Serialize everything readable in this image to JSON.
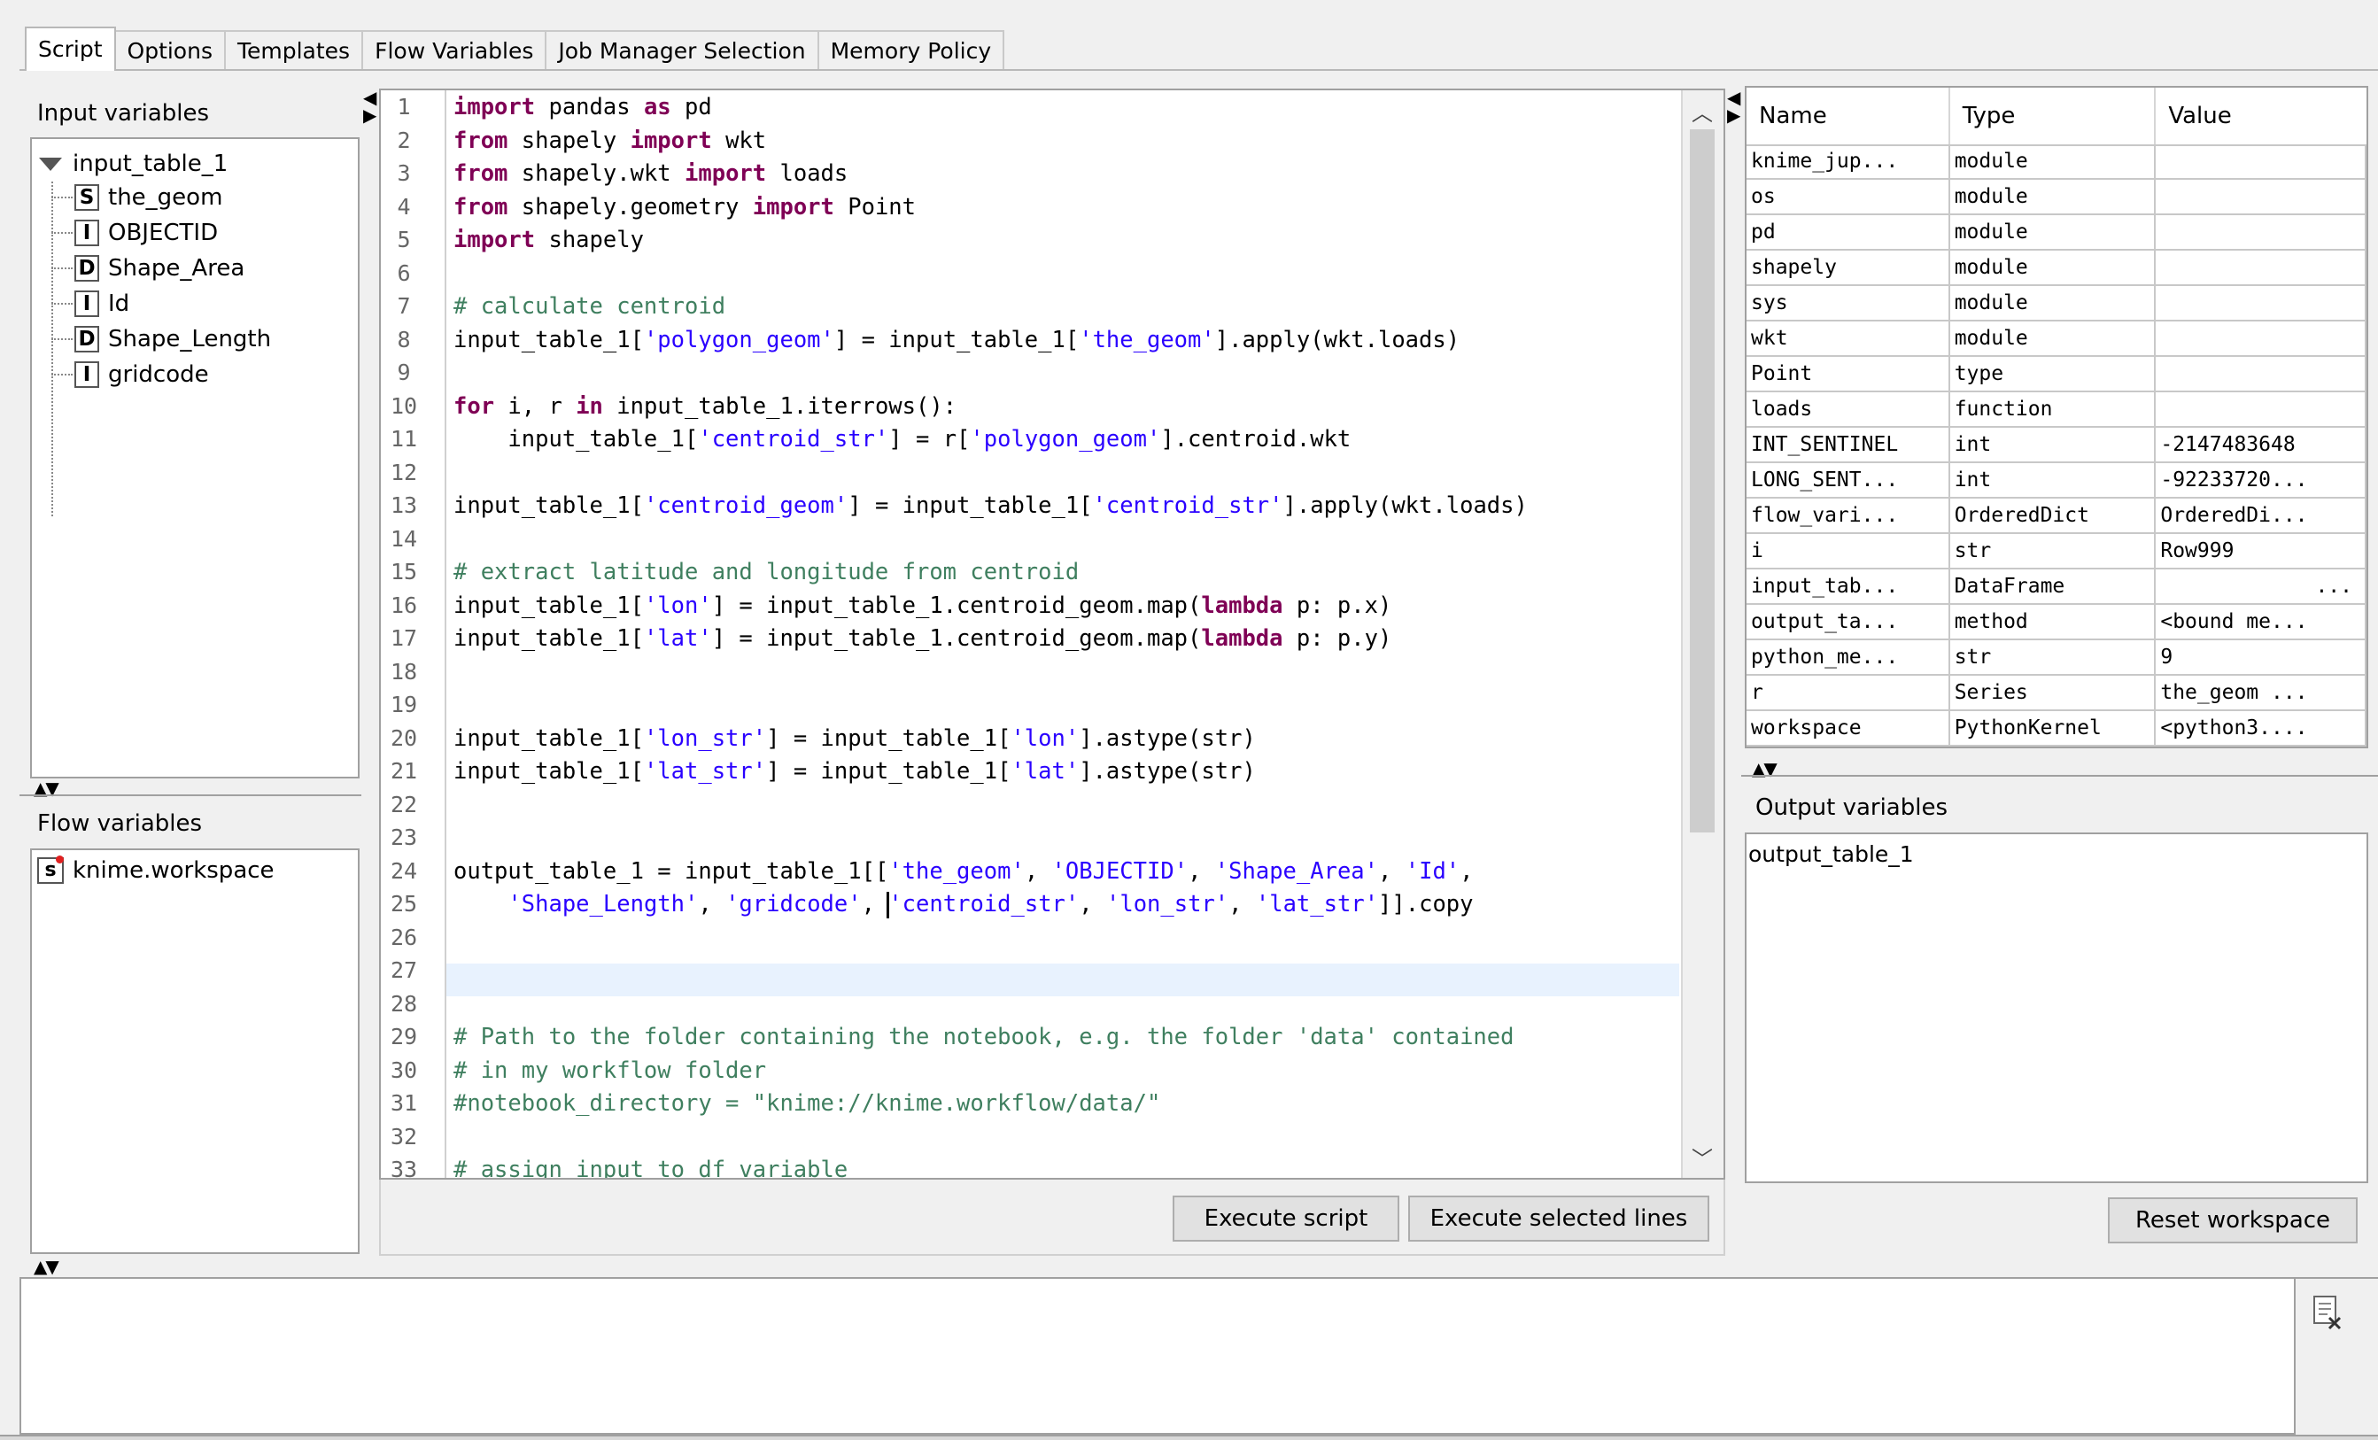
{
  "tabs": [
    "Script",
    "Options",
    "Templates",
    "Flow Variables",
    "Job Manager Selection",
    "Memory Policy"
  ],
  "input_variables": {
    "label": "Input variables",
    "root": "input_table_1",
    "columns": [
      {
        "type": "S",
        "name": "the_geom"
      },
      {
        "type": "I",
        "name": "OBJECTID"
      },
      {
        "type": "D",
        "name": "Shape_Area"
      },
      {
        "type": "I",
        "name": "Id"
      },
      {
        "type": "D",
        "name": "Shape_Length"
      },
      {
        "type": "I",
        "name": "gridcode"
      }
    ]
  },
  "flow_variables": {
    "label": "Flow variables",
    "items": [
      {
        "type": "s",
        "name": "knime.workspace"
      }
    ]
  },
  "code": {
    "line_numbers": [
      "1",
      "2",
      "3",
      "4",
      "5",
      "6",
      "7",
      "8",
      "9",
      "10",
      "11",
      "12",
      "13",
      "14",
      "15",
      "16",
      "17",
      "18",
      "19",
      "20",
      "21",
      "22",
      "23",
      "24",
      "25",
      "26",
      "27",
      "28",
      "29",
      "30",
      "31",
      "32",
      "33"
    ],
    "lines": [
      "import pandas as pd",
      "from shapely import wkt",
      "from shapely.wkt import loads",
      "from shapely.geometry import Point",
      "import shapely",
      "",
      "# calculate centroid",
      "input_table_1['polygon_geom'] = input_table_1['the_geom'].apply(wkt.loads)",
      "",
      "for i, r in input_table_1.iterrows():",
      "    input_table_1['centroid_str'] = r['polygon_geom'].centroid.wkt",
      "",
      "input_table_1['centroid_geom'] = input_table_1['centroid_str'].apply(wkt.loads)",
      "",
      "# extract latitude and longitude from centroid",
      "input_table_1['lon'] = input_table_1.centroid_geom.map(lambda p: p.x)",
      "input_table_1['lat'] = input_table_1.centroid_geom.map(lambda p: p.y)",
      "",
      "",
      "input_table_1['lon_str'] = input_table_1['lon'].astype(str)",
      "input_table_1['lat_str'] = input_table_1['lat'].astype(str)",
      "",
      "",
      "output_table_1 = input_table_1[['the_geom', 'OBJECTID', 'Shape_Area', 'Id',",
      "    'Shape_Length', 'gridcode', 'centroid_str', 'lon_str', 'lat_str']].copy",
      "",
      "",
      "",
      "# Path to the folder containing the notebook, e.g. the folder 'data' contained",
      "# in my workflow folder",
      "#notebook_directory = \"knime://knime.workflow/data/\"",
      "",
      "# assign input to df variable"
    ]
  },
  "buttons": {
    "execute_script": "Execute script",
    "execute_selected": "Execute selected lines",
    "reset_workspace": "Reset workspace"
  },
  "workspace_table": {
    "headers": [
      "Name",
      "Type",
      "Value"
    ],
    "rows": [
      [
        "knime_jup...",
        "module",
        ""
      ],
      [
        "os",
        "module",
        ""
      ],
      [
        "pd",
        "module",
        ""
      ],
      [
        "shapely",
        "module",
        ""
      ],
      [
        "sys",
        "module",
        ""
      ],
      [
        "wkt",
        "module",
        ""
      ],
      [
        "Point",
        "type",
        ""
      ],
      [
        "loads",
        "function",
        ""
      ],
      [
        "INT_SENTINEL",
        "int",
        "-2147483648"
      ],
      [
        "LONG_SENT...",
        "int",
        "-92233720..."
      ],
      [
        "flow_vari...",
        "OrderedDict",
        "OrderedDi..."
      ],
      [
        "i",
        "str",
        "Row999"
      ],
      [
        "input_tab...",
        "DataFrame",
        "..."
      ],
      [
        "output_ta...",
        "method",
        "<bound me..."
      ],
      [
        "python_me...",
        "str",
        "9"
      ],
      [
        "r",
        "Series",
        "the_geom ..."
      ],
      [
        "workspace",
        "PythonKernel",
        "<python3...."
      ]
    ]
  },
  "output_variables": {
    "label": "Output variables",
    "items": [
      "output_table_1"
    ]
  },
  "icons": {
    "tree_expand": "triangle-down-icon",
    "splitter": "splitter-arrows-icon",
    "clear_console": "clear-console-icon"
  }
}
